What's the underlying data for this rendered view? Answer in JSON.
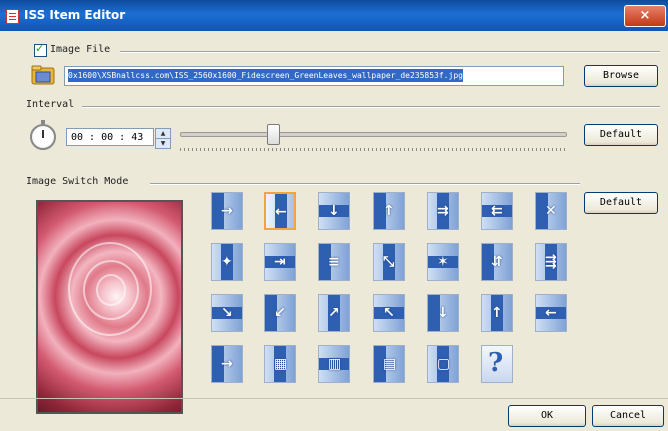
{
  "window": {
    "title": "ISS Item Editor",
    "close_glyph": "×"
  },
  "image_file": {
    "label": "Image File",
    "checked": true,
    "path": "0x1600\\XSBnallcss.com\\ISS_2560x1600_Fidescreen_GreenLeaves_wallpaper_de235853f.jpg",
    "browse_label": "Browse"
  },
  "interval": {
    "label": "Interval",
    "time": "00 : 00 : 43",
    "default_label": "Default",
    "slider_level": 0.24
  },
  "switch_mode": {
    "label": "Image Switch Mode",
    "default_label": "Default",
    "selected_index": 1
  },
  "footer": {
    "ok_label": "OK",
    "cancel_label": "Cancel"
  },
  "icons": [
    "folder-icon",
    "stopwatch-icon",
    "close-icon"
  ],
  "colors": {
    "title_bar": "#1d6ed3",
    "selection": "#316ac5",
    "tile_highlight": "#f4a43c"
  }
}
